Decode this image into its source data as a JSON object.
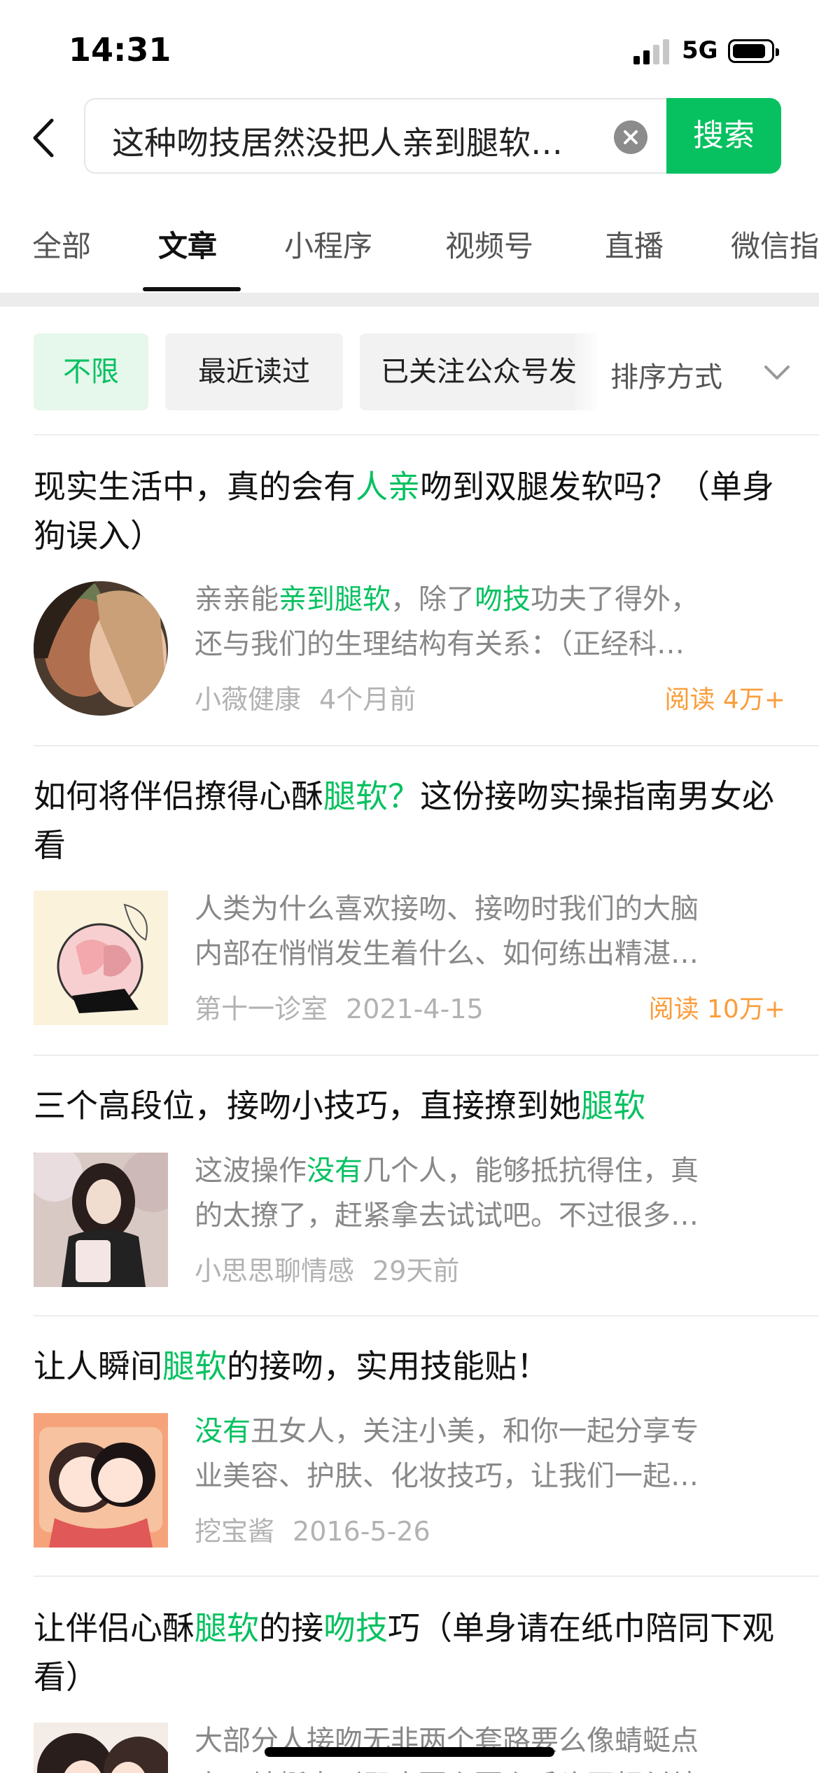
{
  "status_bar": {
    "time": "14:31",
    "network": "5G"
  },
  "search": {
    "query": "这种吻技居然没把人亲到腿软…",
    "button_label": "搜索"
  },
  "tabs": [
    {
      "label": "全部"
    },
    {
      "label": "文章",
      "active": true
    },
    {
      "label": "小程序"
    },
    {
      "label": "视频号"
    },
    {
      "label": "直播"
    },
    {
      "label": "微信指"
    }
  ],
  "filters": {
    "chips": [
      {
        "label": "不限",
        "active": true
      },
      {
        "label": "最近读过"
      },
      {
        "label": "已关注公众号发"
      }
    ],
    "sort_label": "排序方式"
  },
  "colors": {
    "accent": "#07c160",
    "read_count": "#fa9d3b",
    "meta": "#b2b2b2"
  },
  "articles": [
    {
      "title_parts": [
        "现实生活中，真的会有",
        "人亲",
        "吻到双腿发软吗？（单身狗误入）"
      ],
      "snippet_line1": [
        "亲亲能",
        "亲到腿软",
        "，除了",
        "吻技",
        "功夫了得外，"
      ],
      "snippet_line2": "还与我们的生理结构有关系：（正经科…",
      "source": "小薇健康",
      "time": "4个月前",
      "reads": "阅读 4万+",
      "thumb_icon": "couple-kiss-photo"
    },
    {
      "title_parts": [
        "如何将伴侣撩得心酥",
        "腿软？",
        "这份接吻实操指南男女必看"
      ],
      "snippet_line1": "人类为什么喜欢接吻、接吻时我们的大脑",
      "snippet_line2": "内部在悄悄发生着什么、如何练出精湛…",
      "source": "第十一诊室",
      "time": "2021-4-15",
      "reads": "阅读 10万+",
      "thumb_icon": "kiss-illustration"
    },
    {
      "title_parts": [
        "三个高段位，接吻小技巧，直接撩到她",
        "腿软",
        ""
      ],
      "snippet_line1": [
        "这波操作",
        "没有",
        "几个人，能够抵抗得住，真"
      ],
      "snippet_line2": "的太撩了，赶紧拿去试试吧。不过很多…",
      "source": "小思思聊情感",
      "time": "29天前",
      "thumb_icon": "girl-photo"
    },
    {
      "title_parts": [
        "让人瞬间",
        "腿软",
        "的接吻，实用技能贴！"
      ],
      "snippet_line1": [
        "没有",
        "丑女人，关注小美，和你一起分享专"
      ],
      "snippet_line2": "业美容、护肤、化妆技巧，让我们一起…",
      "source": "挖宝酱",
      "time": "2016-5-26",
      "thumb_icon": "cartoon-couple"
    },
    {
      "title_parts": [
        "让伴侣心酥",
        "腿软",
        "的接",
        "吻技",
        "巧（单身请在纸巾陪同下观看）"
      ],
      "snippet_line1": "大部分人接吻无非两个套路要么像蜻蜓点",
      "snippet_line2": "水，蜻蜓点到即止要么要么舌头互相纠缠",
      "thumb_icon": "comic-couple"
    }
  ]
}
